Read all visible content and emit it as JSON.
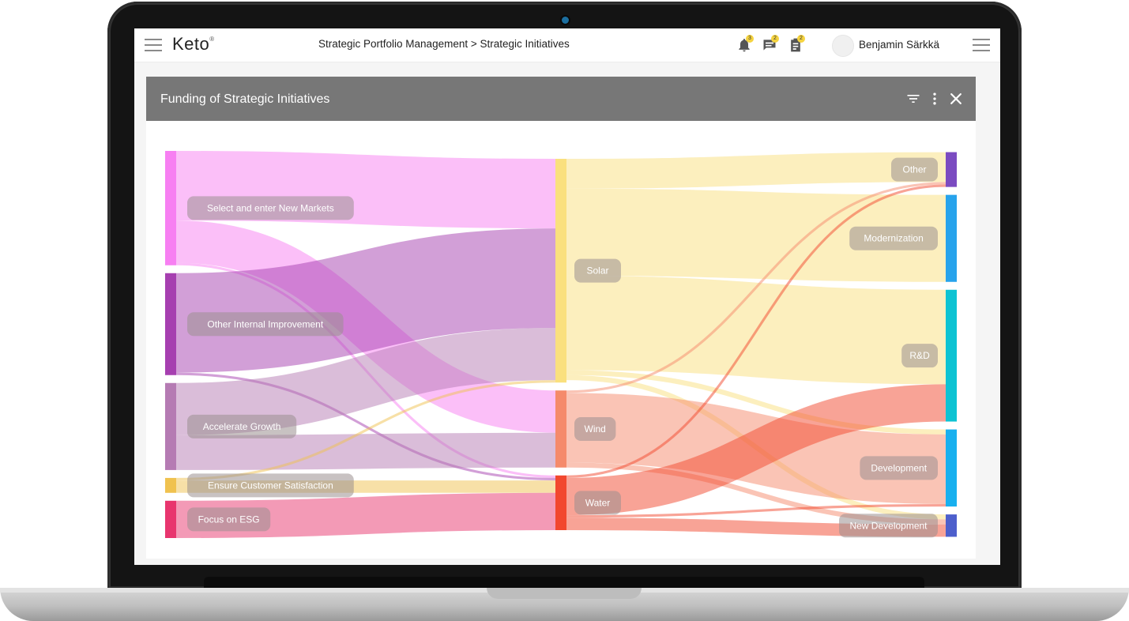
{
  "app": {
    "logo": "Keto",
    "logo_mark": "®",
    "breadcrumb": "Strategic Portfolio Management > Strategic Initiatives",
    "username": "Benjamin Särkkä",
    "notifications": [
      {
        "icon": "bell-icon",
        "count": "3"
      },
      {
        "icon": "chat-icon",
        "count": "2"
      },
      {
        "icon": "clipboard-icon",
        "count": "2"
      }
    ]
  },
  "panel": {
    "title": "Funding of Strategic Initiatives",
    "actions": [
      "filter-icon",
      "more-vert-icon",
      "close-icon"
    ]
  },
  "chart_data": {
    "type": "sankey",
    "stages": [
      [
        "Select and enter New Markets",
        "Other Internal Improvement",
        "Accelerate Growth",
        "Ensure Customer Satisfaction",
        "Focus on ESG"
      ],
      [
        "Solar",
        "Wind",
        "Water"
      ],
      [
        "Other",
        "Modernization",
        "R&D",
        "Development",
        "New Development"
      ]
    ],
    "nodes": [
      {
        "id": "Select and enter New Markets",
        "color": "#F77FF2"
      },
      {
        "id": "Other Internal Improvement",
        "color": "#A63FB0"
      },
      {
        "id": "Accelerate Growth",
        "color": "#B57BB3"
      },
      {
        "id": "Ensure Customer Satisfaction",
        "color": "#F0C24F"
      },
      {
        "id": "Focus on ESG",
        "color": "#E8356E"
      },
      {
        "id": "Solar",
        "color": "#FAE07E"
      },
      {
        "id": "Wind",
        "color": "#F58A6B"
      },
      {
        "id": "Water",
        "color": "#F2472E"
      },
      {
        "id": "Other",
        "color": "#7B4BC1"
      },
      {
        "id": "Modernization",
        "color": "#27A3EC"
      },
      {
        "id": "R&D",
        "color": "#0DC3D3"
      },
      {
        "id": "Development",
        "color": "#18B0EF"
      },
      {
        "id": "New Development",
        "color": "#4D5FCC"
      }
    ],
    "links": [
      {
        "source": "Select and enter New Markets",
        "target": "Solar",
        "value": 28
      },
      {
        "source": "Select and enter New Markets",
        "target": "Wind",
        "value": 17
      },
      {
        "source": "Select and enter New Markets",
        "target": "Water",
        "value": 1
      },
      {
        "source": "Other Internal Improvement",
        "target": "Solar",
        "value": 40
      },
      {
        "source": "Other Internal Improvement",
        "target": "Water",
        "value": 1
      },
      {
        "source": "Accelerate Growth",
        "target": "Solar",
        "value": 21
      },
      {
        "source": "Accelerate Growth",
        "target": "Wind",
        "value": 14
      },
      {
        "source": "Ensure Customer Satisfaction",
        "target": "Solar",
        "value": 1
      },
      {
        "source": "Ensure Customer Satisfaction",
        "target": "Water",
        "value": 5
      },
      {
        "source": "Focus on ESG",
        "target": "Water",
        "value": 15
      },
      {
        "source": "Solar",
        "target": "Other",
        "value": 12
      },
      {
        "source": "Solar",
        "target": "Modernization",
        "value": 35
      },
      {
        "source": "Solar",
        "target": "R&D",
        "value": 38
      },
      {
        "source": "Solar",
        "target": "Development",
        "value": 2
      },
      {
        "source": "Solar",
        "target": "New Development",
        "value": 2
      },
      {
        "source": "Wind",
        "target": "Other",
        "value": 1
      },
      {
        "source": "Wind",
        "target": "Development",
        "value": 28
      },
      {
        "source": "Wind",
        "target": "New Development",
        "value": 2
      },
      {
        "source": "Water",
        "target": "Other",
        "value": 1
      },
      {
        "source": "Water",
        "target": "R&D",
        "value": 15
      },
      {
        "source": "Water",
        "target": "Development",
        "value": 1
      },
      {
        "source": "Water",
        "target": "New Development",
        "value": 5
      }
    ]
  }
}
